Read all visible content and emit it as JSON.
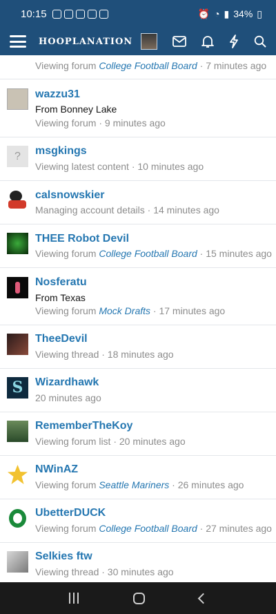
{
  "status_bar": {
    "time": "10:15",
    "battery": "34%"
  },
  "app_bar": {
    "logo": "HOOPLANATION",
    "icons": [
      "menu-icon",
      "avatar",
      "mail-icon",
      "bell-icon",
      "lightning-icon",
      "search-icon"
    ]
  },
  "members": [
    {
      "name": "",
      "line1_prefix": "Viewing forum ",
      "line1_link": "College Football Board",
      "line1_suffix": " · 7 minutes ago",
      "avatar_color": "#2a5a9a"
    },
    {
      "name": "wazzu31",
      "from": "From Bonney Lake",
      "line1_prefix": "Viewing forum · 9 minutes ago",
      "avatar_color": "#b8b0a0"
    },
    {
      "name": "msgkings",
      "line1_prefix": "Viewing latest content · 10 minutes ago",
      "avatar_glyph": "?",
      "avatar_color": "#e4e4e4"
    },
    {
      "name": "calsnowskier",
      "line1_prefix": "Managing account details · 14 minutes ago",
      "avatar_color": "#d23a2a"
    },
    {
      "name": "THEE Robot Devil",
      "line1_prefix": "Viewing forum ",
      "line1_link": "College Football Board",
      "line1_suffix": " · 15 minutes ago",
      "avatar_color": "#1e5a1e"
    },
    {
      "name": "Nosferatu",
      "from": "From Texas",
      "line1_prefix": "Viewing forum ",
      "line1_link": "Mock Drafts",
      "line1_suffix": " · 17 minutes ago",
      "avatar_color": "#111111"
    },
    {
      "name": "TheeDevil",
      "line1_prefix": "Viewing thread · 18 minutes ago",
      "avatar_color": "#6a2a2a"
    },
    {
      "name": "Wizardhawk",
      "line1_prefix": "20 minutes ago",
      "avatar_color": "#0e2a3e"
    },
    {
      "name": "RememberTheKoy",
      "line1_prefix": "Viewing forum list · 20 minutes ago",
      "avatar_color": "#3a6a3a"
    },
    {
      "name": "NWinAZ",
      "line1_prefix": "Viewing forum ",
      "line1_link": "Seattle Mariners",
      "line1_suffix": " · 26 minutes ago",
      "avatar_color": "#f2c230"
    },
    {
      "name": "UbetterDUCK",
      "line1_prefix": "Viewing forum ",
      "line1_link": "College Football Board",
      "line1_suffix": " · 27 minutes ago",
      "avatar_color": "#1a7a3a"
    },
    {
      "name": "Selkies ftw",
      "line1_prefix": "Viewing thread · 30 minutes ago",
      "avatar_color": "#9a9a9a"
    }
  ]
}
